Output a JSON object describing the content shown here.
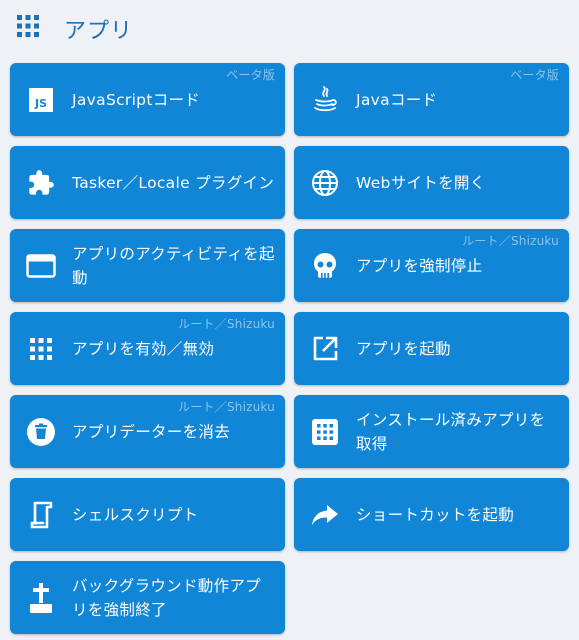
{
  "header": {
    "title": "アプリ",
    "icon": "apps-grid-icon"
  },
  "cards": [
    {
      "label": "JavaScriptコード",
      "badge": "ベータ版",
      "icon": "javascript-icon"
    },
    {
      "label": "Javaコード",
      "badge": "ベータ版",
      "icon": "java-icon"
    },
    {
      "label": "Tasker／Locale プラグイン",
      "badge": "",
      "icon": "puzzle-icon"
    },
    {
      "label": "Webサイトを開く",
      "badge": "",
      "icon": "globe-icon"
    },
    {
      "label": "アプリのアクティビティを起動",
      "badge": "",
      "icon": "window-icon"
    },
    {
      "label": "アプリを強制停止",
      "badge": "ルート／Shizuku",
      "icon": "skull-icon"
    },
    {
      "label": "アプリを有効／無効",
      "badge": "ルート／Shizuku",
      "icon": "apps-grid-icon"
    },
    {
      "label": "アプリを起動",
      "badge": "",
      "icon": "open-in-new-icon"
    },
    {
      "label": "アプリデーターを消去",
      "badge": "ルート／Shizuku",
      "icon": "trash-icon"
    },
    {
      "label": "インストール済みアプリを取得",
      "badge": "",
      "icon": "dialpad-icon"
    },
    {
      "label": "シェルスクリプト",
      "badge": "",
      "icon": "script-icon"
    },
    {
      "label": "ショートカットを起動",
      "badge": "",
      "icon": "share-arrow-icon"
    },
    {
      "label": "バックグラウンド動作アプリを強制終了",
      "badge": "",
      "icon": "grave-icon"
    }
  ],
  "colors": {
    "card": "#1185d6",
    "header": "#1f6fb8",
    "badge": "#8fc3ea",
    "background": "#eef1f5"
  }
}
